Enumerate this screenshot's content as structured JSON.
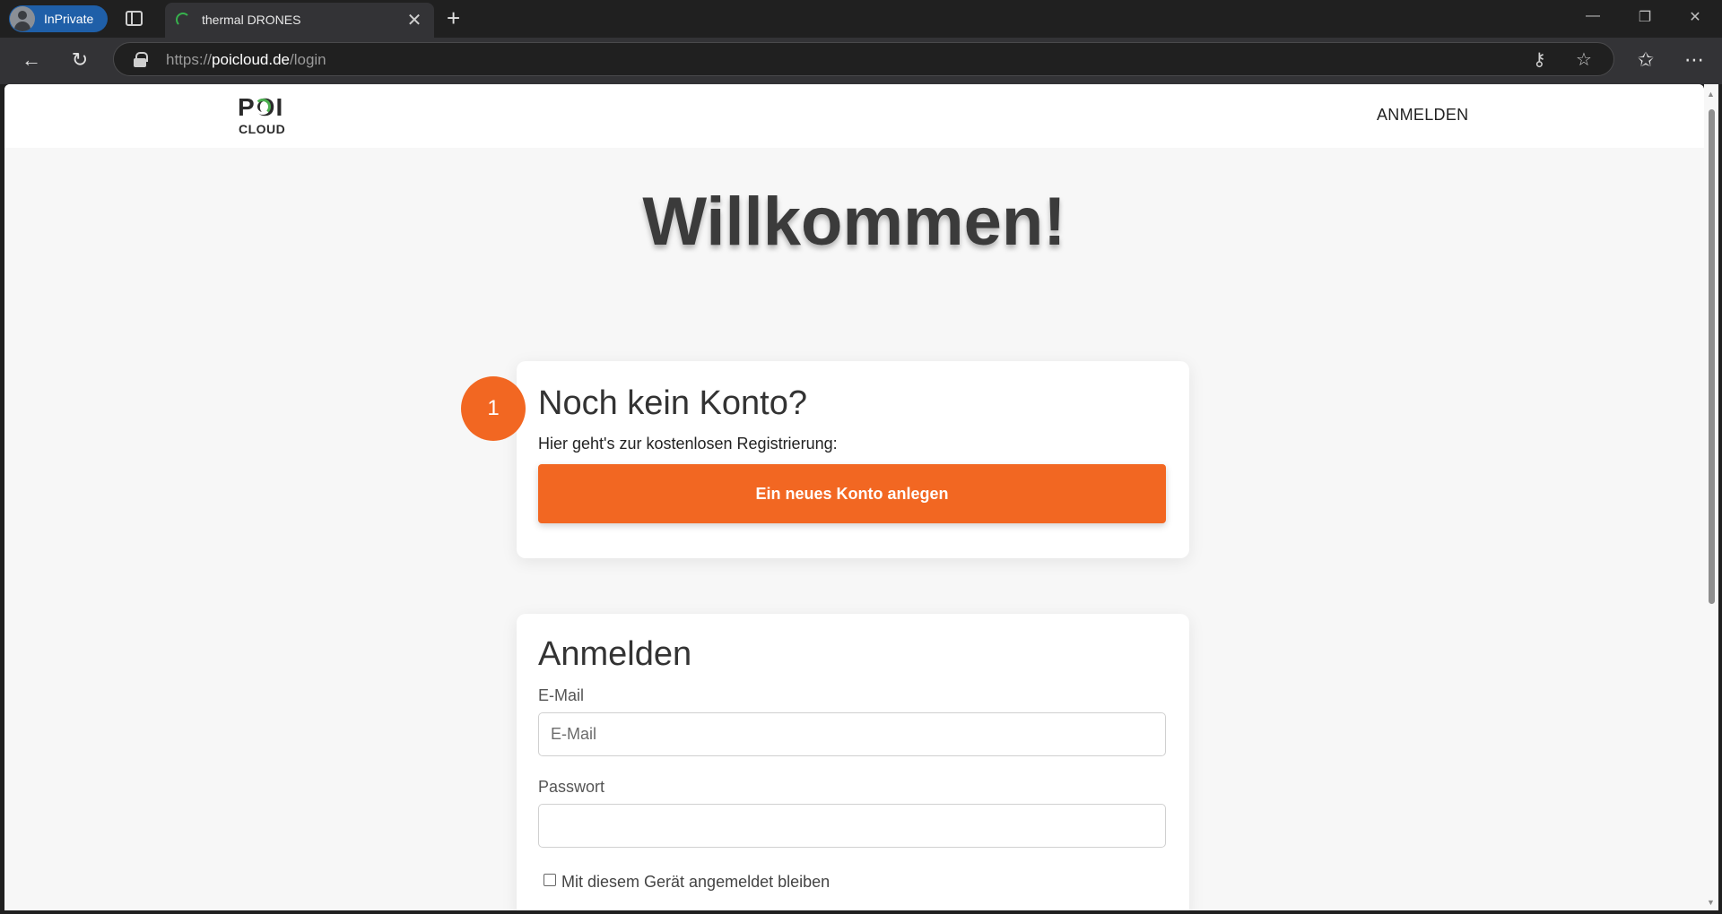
{
  "browser": {
    "profile_label": "InPrivate",
    "tab_title": "thermal DRONES",
    "url_scheme": "https://",
    "url_domain": "poicloud.de",
    "url_path": "/login"
  },
  "nav": {
    "logo_top": "POI",
    "logo_bottom": "CLOUD",
    "login_link": "ANMELDEN"
  },
  "page": {
    "welcome_heading": "Willkommen!"
  },
  "register_card": {
    "title": "Noch kein Konto?",
    "subtitle": "Hier geht's zur kostenlosen Registrierung:",
    "button_label": "Ein neues Konto anlegen",
    "step_badge": "1"
  },
  "login_card": {
    "title": "Anmelden",
    "email_label": "E-Mail",
    "email_placeholder": "E-Mail",
    "email_value": "",
    "password_label": "Passwort",
    "password_value": "",
    "remember_label": "Mit diesem Gerät angemeldet bleiben",
    "remember_checked": false
  },
  "colors": {
    "accent": "#f26722",
    "logo_green": "#4caf50"
  }
}
